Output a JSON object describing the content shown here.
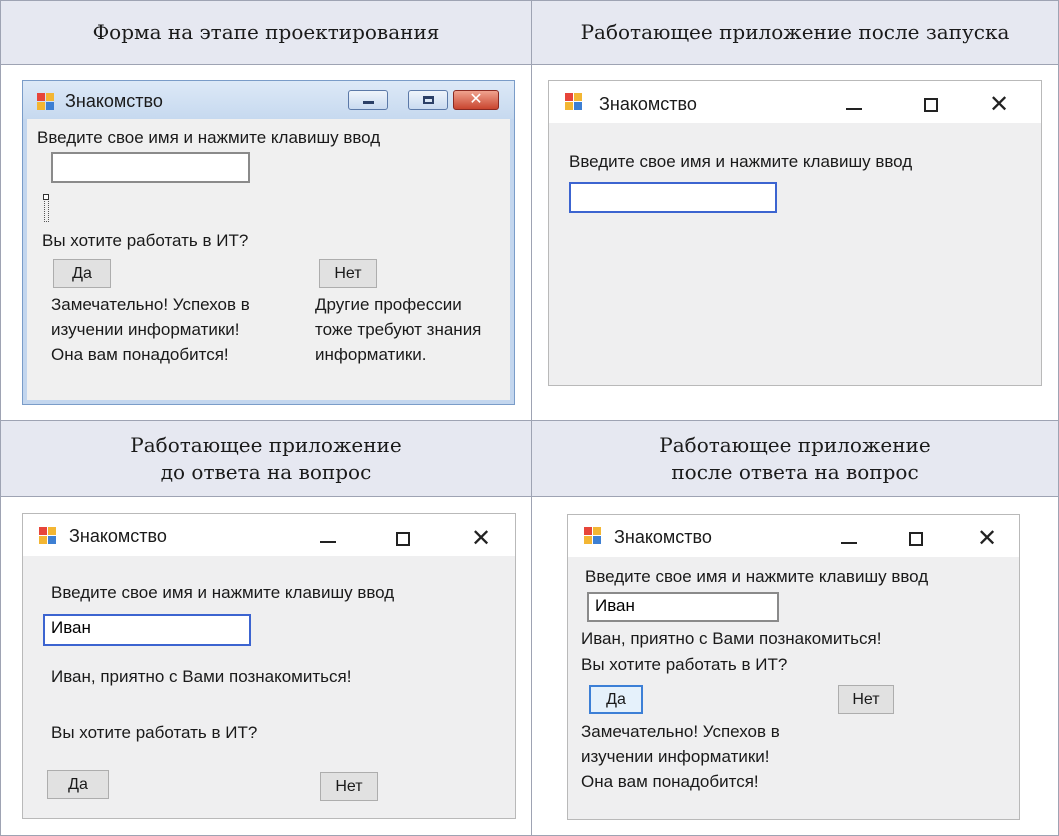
{
  "headers": {
    "design": "Форма на этапе проектирования",
    "running": "Работающее приложение после запуска",
    "before_answer": "Работающее приложение\nдо ответа на вопрос",
    "after_answer": "Работающее приложение\nпосле ответа на вопрос"
  },
  "window_title": "Знакомство",
  "prompt_label": "Введите свое имя и нажмите клавишу ввод",
  "name_value": "Иван",
  "greeting": "Иван, приятно с Вами познакомиться!",
  "question": "Вы хотите работать в ИТ?",
  "yes_button": "Да",
  "no_button": "Нет",
  "yes_reply": "Замечательно! Успехов в изучении информатики! Она вам понадобится!",
  "no_reply": "Другие профессии тоже требуют знания информатики.",
  "colors": {
    "header_bg": "#e6e8f1",
    "focus_border": "#3c64d0",
    "classic_frame": "#c3d6ee"
  }
}
